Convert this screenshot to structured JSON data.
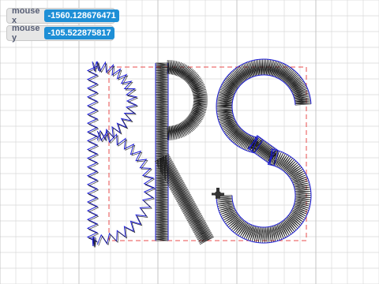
{
  "monitors": {
    "mouse_x": {
      "label": "mouse x",
      "value": "-1560.128676471"
    },
    "mouse_y": {
      "label": "mouse y",
      "value": "-105.522875817"
    }
  },
  "colors": {
    "grid": "#d9d9d9",
    "stitch": "#1a1a1a",
    "outline": "#1f1fd6",
    "bbox": "#e84d4d",
    "monitor_bg": "#e6e6e6",
    "value_bg": "#1e8fd6"
  },
  "icons": {
    "sprite": "embroidery-pen-sprite"
  }
}
